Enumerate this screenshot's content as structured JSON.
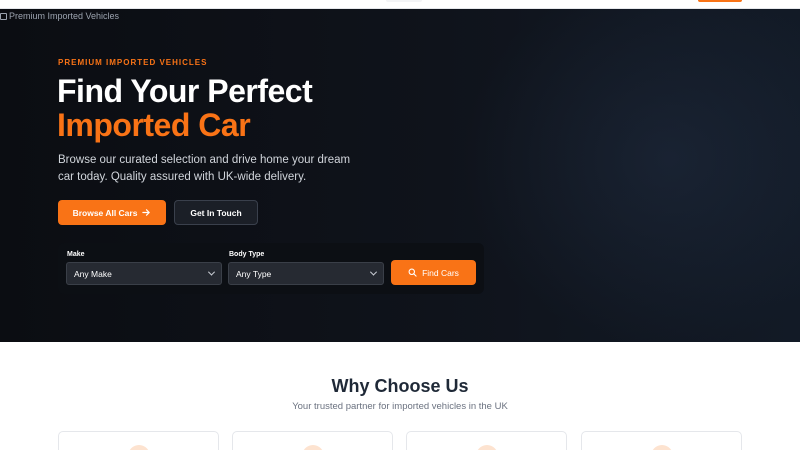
{
  "header": {
    "logo_alt": "Premium Imported Vehicles"
  },
  "hero": {
    "eyebrow": "PREMIUM IMPORTED VEHICLES",
    "title_line1": "Find Your Perfect",
    "title_line2": "Imported Car",
    "subtitle": "Browse our curated selection and drive home your dream car today. Quality assured with UK-wide delivery.",
    "primary_button": "Browse All Cars",
    "secondary_button": "Get In Touch"
  },
  "search": {
    "make_label": "Make",
    "make_value": "Any Make",
    "body_type_label": "Body Type",
    "body_type_value": "Any Type",
    "find_button": "Find Cars"
  },
  "why": {
    "title": "Why Choose Us",
    "subtitle": "Your trusted partner for imported vehicles in the UK"
  },
  "colors": {
    "accent": "#f97316",
    "hero_bg": "#0f131b"
  },
  "icons": [
    "arrow-right-icon",
    "search-icon",
    "chevron-down-icon",
    "broken-image-icon"
  ]
}
